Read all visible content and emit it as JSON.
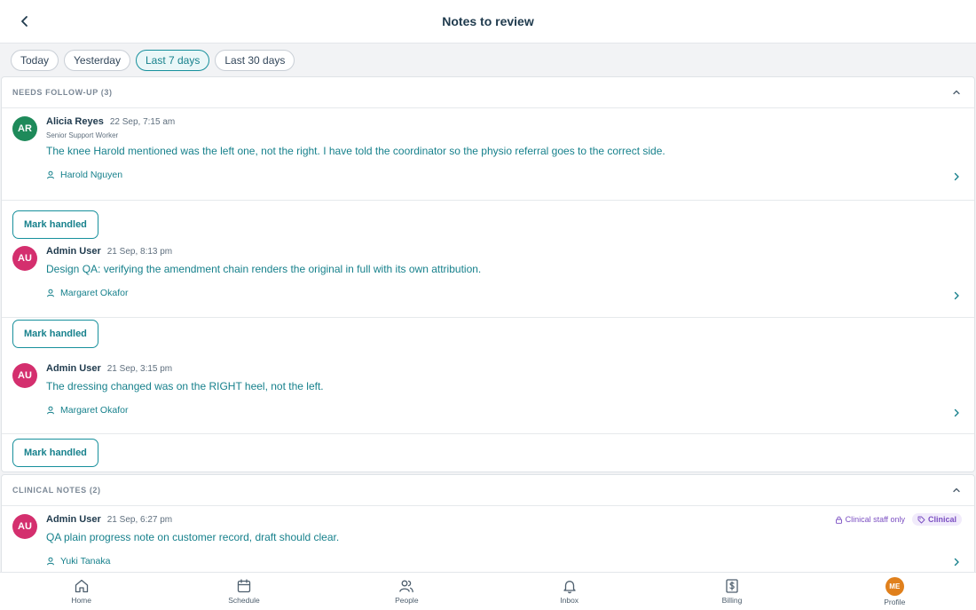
{
  "header": {
    "title": "Notes to review"
  },
  "filters": [
    {
      "label": "Today",
      "active": false
    },
    {
      "label": "Yesterday",
      "active": false
    },
    {
      "label": "Last 7 days",
      "active": true
    },
    {
      "label": "Last 30 days",
      "active": false
    }
  ],
  "sections": [
    {
      "title": "NEEDS FOLLOW-UP (3)",
      "notes": [
        {
          "initials": "AR",
          "avatar_color": "#1e8a5a",
          "author": "Alicia Reyes",
          "timestamp": "22 Sep, 7:15 am",
          "role": "Senior Support Worker",
          "text": "The knee Harold mentioned was the left one, not the right. I have told the coordinator so the physio referral goes to the correct side.",
          "client": "Harold Nguyen",
          "action_label": "Mark handled"
        },
        {
          "initials": "AU",
          "avatar_color": "#d42f6e",
          "author": "Admin User",
          "timestamp": "21 Sep, 8:13 pm",
          "text": "Design QA: verifying the amendment chain renders the original in full with its own attribution.",
          "client": "Margaret Okafor",
          "action_label": "Mark handled"
        },
        {
          "initials": "AU",
          "avatar_color": "#d42f6e",
          "author": "Admin User",
          "timestamp": "21 Sep, 3:15 pm",
          "text": "The dressing changed was on the RIGHT heel, not the left.",
          "client": "Margaret Okafor",
          "action_label": "Mark handled"
        }
      ]
    },
    {
      "title": "CLINICAL NOTES (2)",
      "notes": [
        {
          "initials": "AU",
          "avatar_color": "#d42f6e",
          "author": "Admin User",
          "timestamp": "21 Sep, 6:27 pm",
          "text": "QA plain progress note on customer record, draft should clear.",
          "client": "Yuki Tanaka",
          "badge_restricted": "Clinical staff only",
          "badge_category": "Clinical"
        }
      ]
    }
  ],
  "tabbar": [
    {
      "label": "Home",
      "icon": "home-icon"
    },
    {
      "label": "Schedule",
      "icon": "calendar-icon"
    },
    {
      "label": "People",
      "icon": "people-icon"
    },
    {
      "label": "Inbox",
      "icon": "bell-icon"
    },
    {
      "label": "Billing",
      "icon": "billing-icon"
    },
    {
      "label": "Profile",
      "icon": "profile-avatar",
      "initials": "ME"
    }
  ],
  "colors": {
    "accent": "#17909c",
    "accent_text": "#17818c",
    "clinical_purple": "#7b4fc2",
    "profile_orange": "#e0801c"
  }
}
